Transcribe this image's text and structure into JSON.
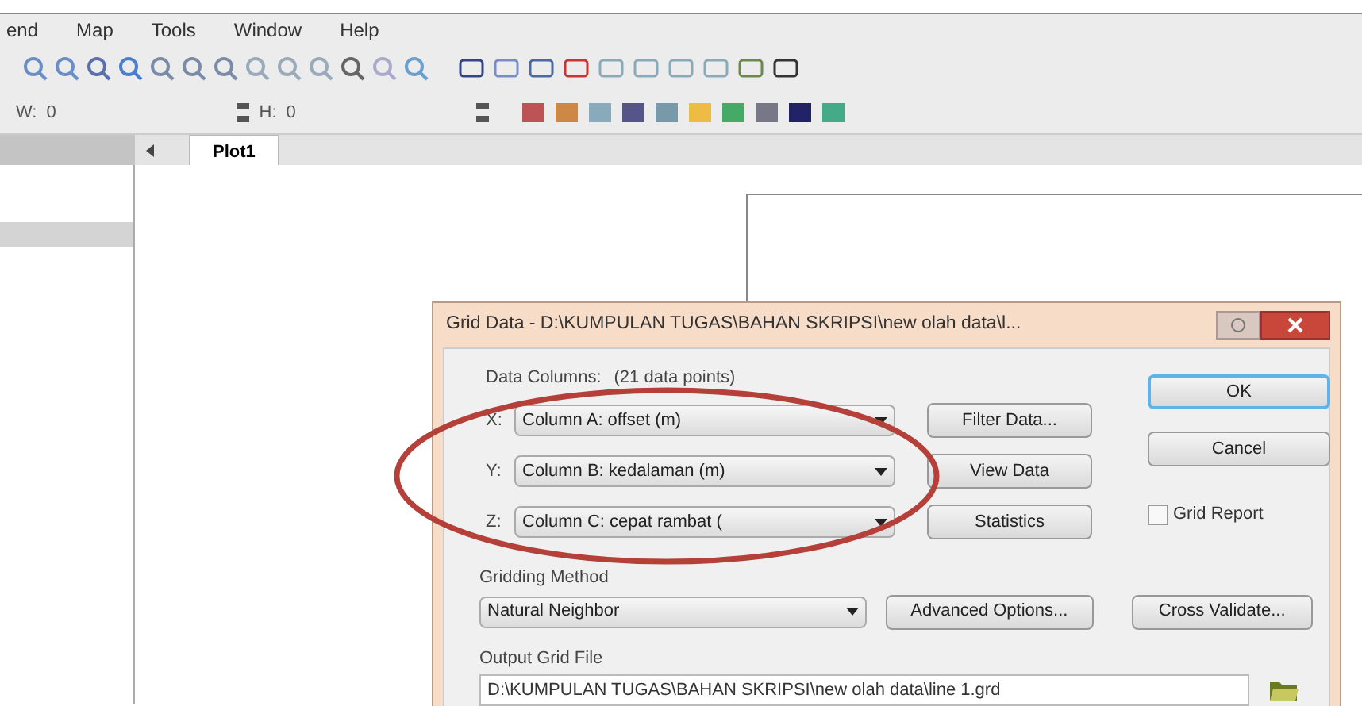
{
  "menu": [
    "end",
    "Map",
    "Tools",
    "Window",
    "Help"
  ],
  "size_bar": {
    "w_label": "W:",
    "w_value": "0",
    "h_label": "H:",
    "h_value": "0"
  },
  "tabs": [
    {
      "label": "Plot1",
      "selected": true
    }
  ],
  "dialog": {
    "title": "Grid Data - D:\\KUMPULAN TUGAS\\BAHAN SKRIPSI\\new olah data\\l...",
    "data_columns": {
      "label": "Data Columns:",
      "count": "(21 data points)",
      "rows": [
        {
          "axis": "X:",
          "value": "Column A:  offset (m)",
          "button": "Filter Data..."
        },
        {
          "axis": "Y:",
          "value": "Column B:  kedalaman (m)",
          "button": "View Data"
        },
        {
          "axis": "Z:",
          "value": "Column C:  cepat rambat (",
          "button": "Statistics"
        }
      ]
    },
    "ok": "OK",
    "cancel": "Cancel",
    "grid_report": {
      "label": "Grid Report",
      "checked": false
    },
    "gridding_method": {
      "label": "Gridding Method",
      "value": "Natural Neighbor",
      "advanced": "Advanced Options...",
      "cross_validate": "Cross Validate..."
    },
    "output": {
      "label": "Output Grid File",
      "value": "D:\\KUMPULAN TUGAS\\BAHAN SKRIPSI\\new olah data\\line 1.grd"
    }
  }
}
